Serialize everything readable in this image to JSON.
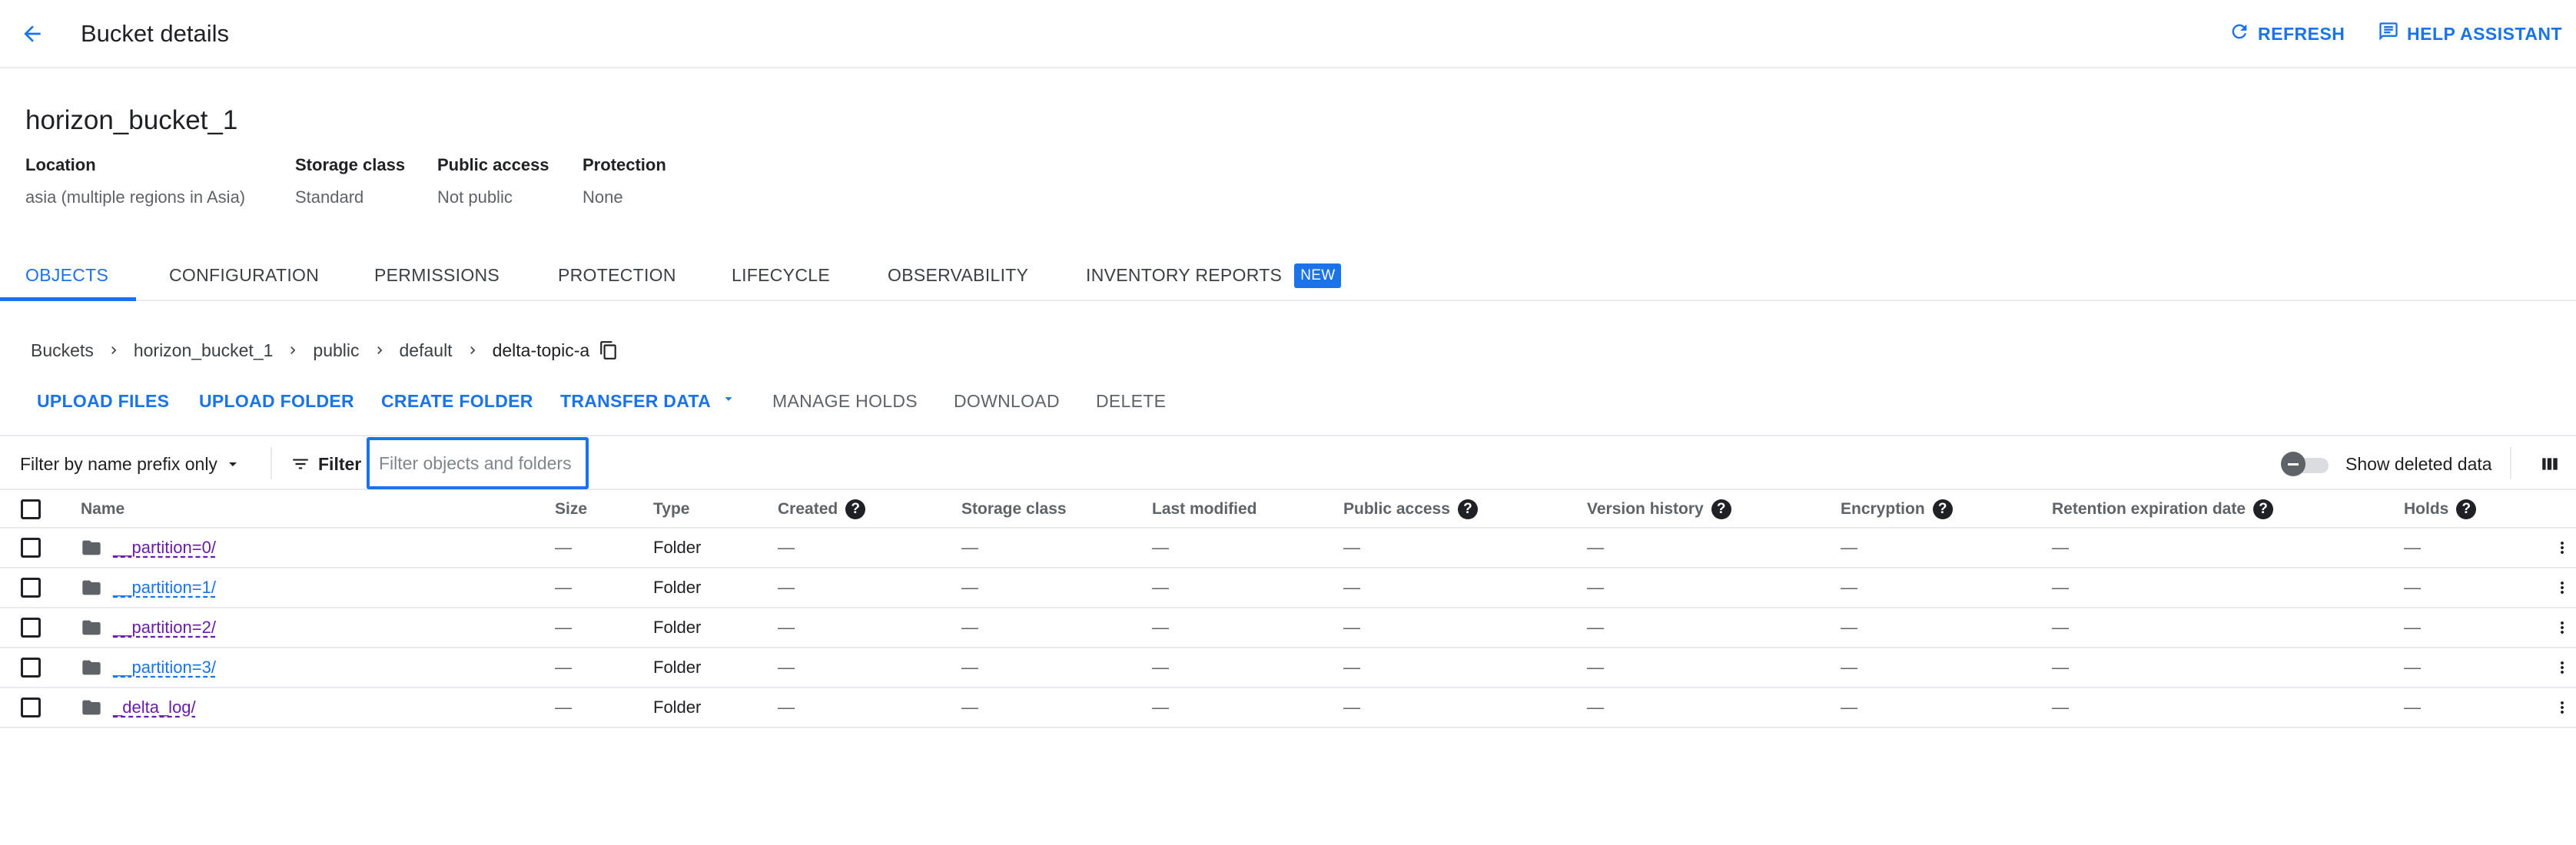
{
  "header": {
    "title": "Bucket details",
    "refresh_label": "REFRESH",
    "help_label": "HELP ASSISTANT"
  },
  "bucket": {
    "name": "horizon_bucket_1",
    "meta": [
      {
        "label": "Location",
        "value": "asia (multiple regions in Asia)"
      },
      {
        "label": "Storage class",
        "value": "Standard"
      },
      {
        "label": "Public access",
        "value": "Not public"
      },
      {
        "label": "Protection",
        "value": "None"
      }
    ]
  },
  "tabs": [
    {
      "label": "OBJECTS",
      "active": true
    },
    {
      "label": "CONFIGURATION"
    },
    {
      "label": "PERMISSIONS"
    },
    {
      "label": "PROTECTION"
    },
    {
      "label": "LIFECYCLE"
    },
    {
      "label": "OBSERVABILITY"
    },
    {
      "label": "INVENTORY REPORTS",
      "badge": "NEW"
    }
  ],
  "breadcrumb": [
    "Buckets",
    "horizon_bucket_1",
    "public",
    "default",
    "delta-topic-a"
  ],
  "actions": {
    "upload_files": "UPLOAD FILES",
    "upload_folder": "UPLOAD FOLDER",
    "create_folder": "CREATE FOLDER",
    "transfer_data": "TRANSFER DATA",
    "manage_holds": "MANAGE HOLDS",
    "download": "DOWNLOAD",
    "delete": "DELETE"
  },
  "filter": {
    "mode": "Filter by name prefix only",
    "button": "Filter",
    "placeholder": "Filter objects and folders",
    "show_deleted": "Show deleted data"
  },
  "table": {
    "columns": [
      "Name",
      "Size",
      "Type",
      "Created",
      "Storage class",
      "Last modified",
      "Public access",
      "Version history",
      "Encryption",
      "Retention expiration date",
      "Holds"
    ],
    "help_mark": "?",
    "rows": [
      {
        "name": "__partition=0/",
        "size": "—",
        "type": "Folder",
        "created": "—",
        "storage_class": "—",
        "last_modified": "—",
        "public_access": "—",
        "version_history": "—",
        "encryption": "—",
        "retention": "—",
        "holds": "—"
      },
      {
        "name": "__partition=1/",
        "size": "—",
        "type": "Folder",
        "created": "—",
        "storage_class": "—",
        "last_modified": "—",
        "public_access": "—",
        "version_history": "—",
        "encryption": "—",
        "retention": "—",
        "holds": "—"
      },
      {
        "name": "__partition=2/",
        "size": "—",
        "type": "Folder",
        "created": "—",
        "storage_class": "—",
        "last_modified": "—",
        "public_access": "—",
        "version_history": "—",
        "encryption": "—",
        "retention": "—",
        "holds": "—"
      },
      {
        "name": "__partition=3/",
        "size": "—",
        "type": "Folder",
        "created": "—",
        "storage_class": "—",
        "last_modified": "—",
        "public_access": "—",
        "version_history": "—",
        "encryption": "—",
        "retention": "—",
        "holds": "—"
      },
      {
        "name": "_delta_log/",
        "size": "—",
        "type": "Folder",
        "created": "—",
        "storage_class": "—",
        "last_modified": "—",
        "public_access": "—",
        "version_history": "—",
        "encryption": "—",
        "retention": "—",
        "holds": "—"
      }
    ]
  },
  "colors": {
    "accent": "#1a73e8",
    "visited_link": "#681da8",
    "text": "#202124",
    "muted": "#5f6368"
  }
}
